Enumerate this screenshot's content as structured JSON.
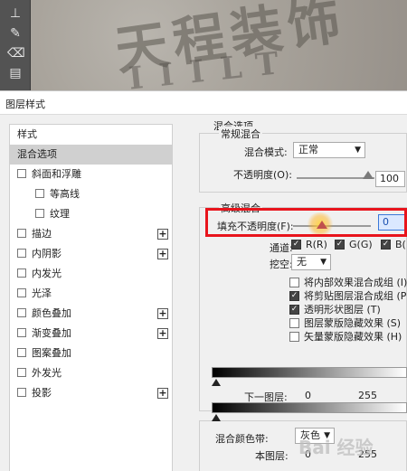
{
  "dialog": {
    "title": "图层样式"
  },
  "styles_list": {
    "header": "样式",
    "selected": "混合选项",
    "items": [
      {
        "label": "斜面和浮雕",
        "checkbox": true,
        "plus": false,
        "indent": false
      },
      {
        "label": "等高线",
        "checkbox": true,
        "plus": false,
        "indent": true
      },
      {
        "label": "纹理",
        "checkbox": true,
        "plus": false,
        "indent": true
      },
      {
        "label": "描边",
        "checkbox": true,
        "plus": true,
        "indent": false
      },
      {
        "label": "内阴影",
        "checkbox": true,
        "plus": true,
        "indent": false
      },
      {
        "label": "内发光",
        "checkbox": true,
        "plus": false,
        "indent": false
      },
      {
        "label": "光泽",
        "checkbox": true,
        "plus": false,
        "indent": false
      },
      {
        "label": "颜色叠加",
        "checkbox": true,
        "plus": true,
        "indent": false
      },
      {
        "label": "渐变叠加",
        "checkbox": true,
        "plus": true,
        "indent": false
      },
      {
        "label": "图案叠加",
        "checkbox": true,
        "plus": false,
        "indent": false
      },
      {
        "label": "外发光",
        "checkbox": true,
        "plus": false,
        "indent": false
      },
      {
        "label": "投影",
        "checkbox": true,
        "plus": true,
        "indent": false
      }
    ]
  },
  "blend_options": {
    "title": "混合选项",
    "general": {
      "title": "常规混合",
      "mode_label": "混合模式:",
      "mode_value": "正常",
      "opacity_label": "不透明度(O):",
      "opacity_value": "100"
    },
    "advanced": {
      "title": "高级混合",
      "fill_label": "填充不透明度(F):",
      "fill_value": "0",
      "channels_label": "通道:",
      "channel_r": "R(R)",
      "channel_g": "G(G)",
      "channel_b": "B(",
      "knockout_label": "挖空:",
      "knockout_value": "无",
      "options": [
        {
          "label": "将内部效果混合成组 (I)",
          "checked": false
        },
        {
          "label": "将剪贴图层混合成组 (P)",
          "checked": true
        },
        {
          "label": "透明形状图层 (T)",
          "checked": true
        },
        {
          "label": "图层蒙版隐藏效果 (S)",
          "checked": false
        },
        {
          "label": "矢量蒙版隐藏效果 (H)",
          "checked": false
        }
      ]
    },
    "blend_if": {
      "label": "混合颜色带:",
      "value": "灰色",
      "this_layer": "本图层:",
      "under_layer": "下一图层:",
      "min": "0",
      "max": "255"
    }
  },
  "watermark": {
    "text": "Bai 经验"
  },
  "colors": {
    "highlight": "#e8141c",
    "selected_row": "#d0d0d0"
  }
}
